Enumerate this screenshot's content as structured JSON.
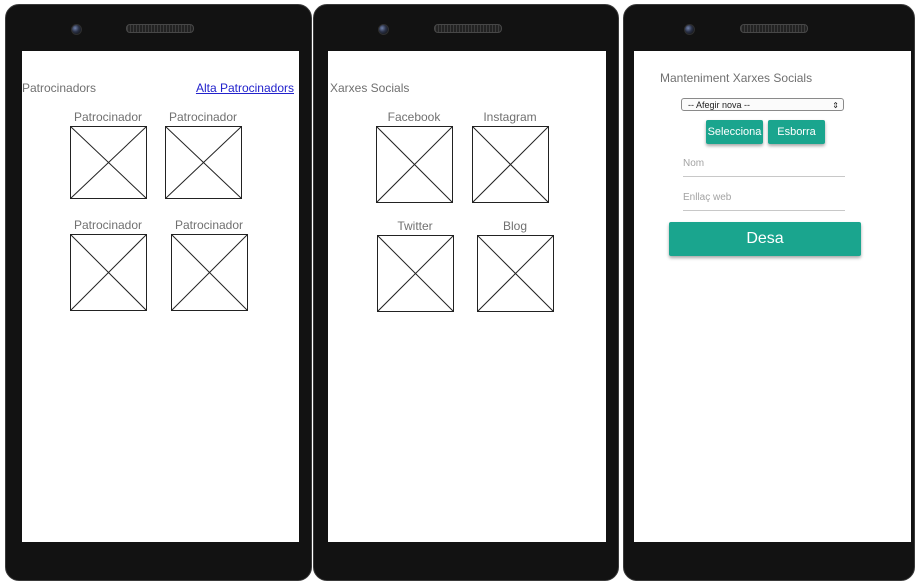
{
  "colors": {
    "accent": "#1aa58e",
    "link": "#2222cc",
    "device": "#121212",
    "screen": "#ffffff",
    "text_muted": "#707070"
  },
  "screen1": {
    "title": "Patrocinadors",
    "link": "Alta Patrocinadors",
    "tiles": [
      {
        "label": "Patrocinador",
        "icon": "image-placeholder-icon"
      },
      {
        "label": "Patrocinador",
        "icon": "image-placeholder-icon"
      },
      {
        "label": "Patrocinador",
        "icon": "image-placeholder-icon"
      },
      {
        "label": "Patrocinador",
        "icon": "image-placeholder-icon"
      }
    ]
  },
  "screen2": {
    "title": "Xarxes Socials",
    "tiles": [
      {
        "label": "Facebook",
        "icon": "image-placeholder-icon"
      },
      {
        "label": "Instagram",
        "icon": "image-placeholder-icon"
      },
      {
        "label": "Twitter",
        "icon": "image-placeholder-icon"
      },
      {
        "label": "Blog",
        "icon": "image-placeholder-icon"
      }
    ]
  },
  "screen3": {
    "title": "Manteniment Xarxes Socials",
    "select": {
      "selected": "-- Afegir nova --"
    },
    "select_button": "Selecciona",
    "delete_button": "Esborra",
    "name_placeholder": "Nom",
    "web_placeholder": "Enllaç web",
    "save_button": "Desa"
  }
}
